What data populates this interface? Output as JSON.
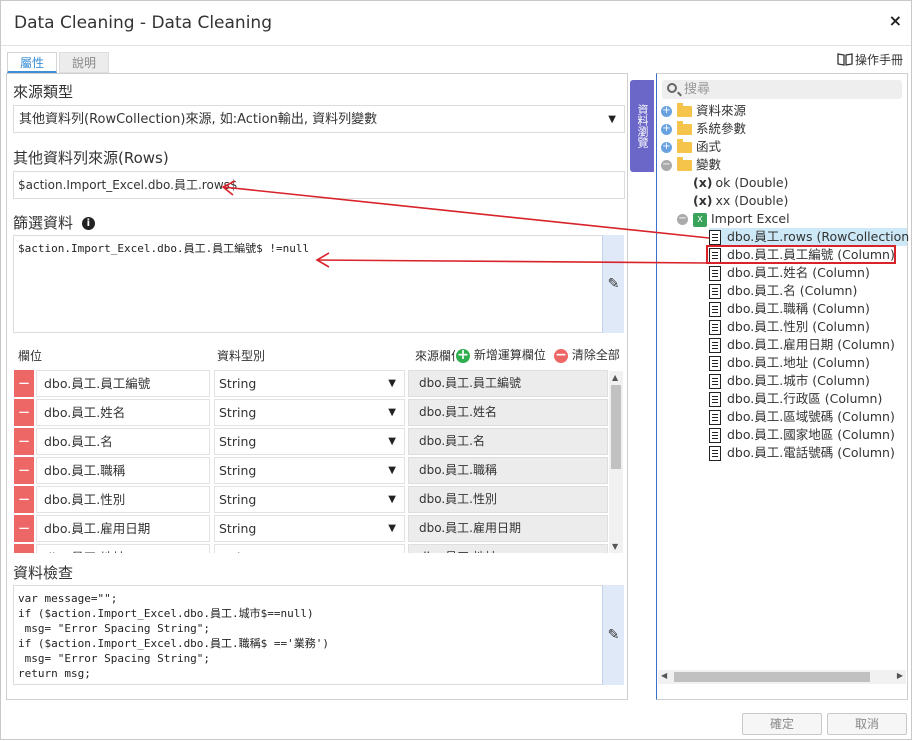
{
  "window": {
    "title": "Data Cleaning - Data Cleaning",
    "close": "×"
  },
  "tabs": [
    {
      "label": "屬性"
    },
    {
      "label": "說明"
    }
  ],
  "manual_label": "操作手冊",
  "side_tab": "資料瀏覽",
  "source_type": {
    "label": "來源類型",
    "value": "其他資料列(RowCollection)來源, 如:Action輸出, 資料列變數"
  },
  "rows_source": {
    "label": "其他資料列來源(Rows)",
    "value": "$action.Import_Excel.dbo.員工.rows$"
  },
  "filter": {
    "label": "篩選資料",
    "info": "i",
    "code": "$action.Import_Excel.dbo.員工.員工編號$ !=null"
  },
  "columns_header": {
    "field": "欄位",
    "type": "資料型別",
    "source": "來源欄位",
    "add": "新增運算欄位",
    "clear": "清除全部"
  },
  "columns": [
    {
      "field": "dbo.員工.員工編號",
      "type": "String",
      "source": "dbo.員工.員工編號"
    },
    {
      "field": "dbo.員工.姓名",
      "type": "String",
      "source": "dbo.員工.姓名"
    },
    {
      "field": "dbo.員工.名",
      "type": "String",
      "source": "dbo.員工.名"
    },
    {
      "field": "dbo.員工.職稱",
      "type": "String",
      "source": "dbo.員工.職稱"
    },
    {
      "field": "dbo.員工.性別",
      "type": "String",
      "source": "dbo.員工.性別"
    },
    {
      "field": "dbo.員工.雇用日期",
      "type": "String",
      "source": "dbo.員工.雇用日期"
    },
    {
      "field": "dbo.員工.地址",
      "type": "String",
      "source": "dbo.員工.地址"
    }
  ],
  "check": {
    "label": "資料檢查",
    "code": "var message=\"\";\nif ($action.Import_Excel.dbo.員工.城市$==null)\n msg= \"Error Spacing String\";\nif ($action.Import_Excel.dbo.員工.職稱$ =='業務')\n msg= \"Error Spacing String\";\nreturn msg;"
  },
  "tree": {
    "search_placeholder": "搜尋",
    "folders": [
      "資料來源",
      "系統參數",
      "函式",
      "變數"
    ],
    "vars": [
      {
        "icon": "(x)",
        "label": "ok (Double)"
      },
      {
        "icon": "(x)",
        "label": "xx (Double)"
      }
    ],
    "import_label": "Import Excel",
    "items": [
      "dbo.員工.rows (RowCollection",
      "dbo.員工.員工編號 (Column)",
      "dbo.員工.姓名 (Column)",
      "dbo.員工.名 (Column)",
      "dbo.員工.職稱 (Column)",
      "dbo.員工.性別 (Column)",
      "dbo.員工.雇用日期 (Column)",
      "dbo.員工.地址 (Column)",
      "dbo.員工.城市 (Column)",
      "dbo.員工.行政區 (Column)",
      "dbo.員工.區域號碼 (Column)",
      "dbo.員工.國家地區 (Column)",
      "dbo.員工.電話號碼 (Column)"
    ]
  },
  "buttons": {
    "ok": "確定",
    "cancel": "取消"
  },
  "colors": {
    "accent": "#3b8fd6",
    "side_tab": "#6b67c9",
    "delete": "#ee6767",
    "add": "#2fae4e",
    "annotation": "#d9232a"
  }
}
